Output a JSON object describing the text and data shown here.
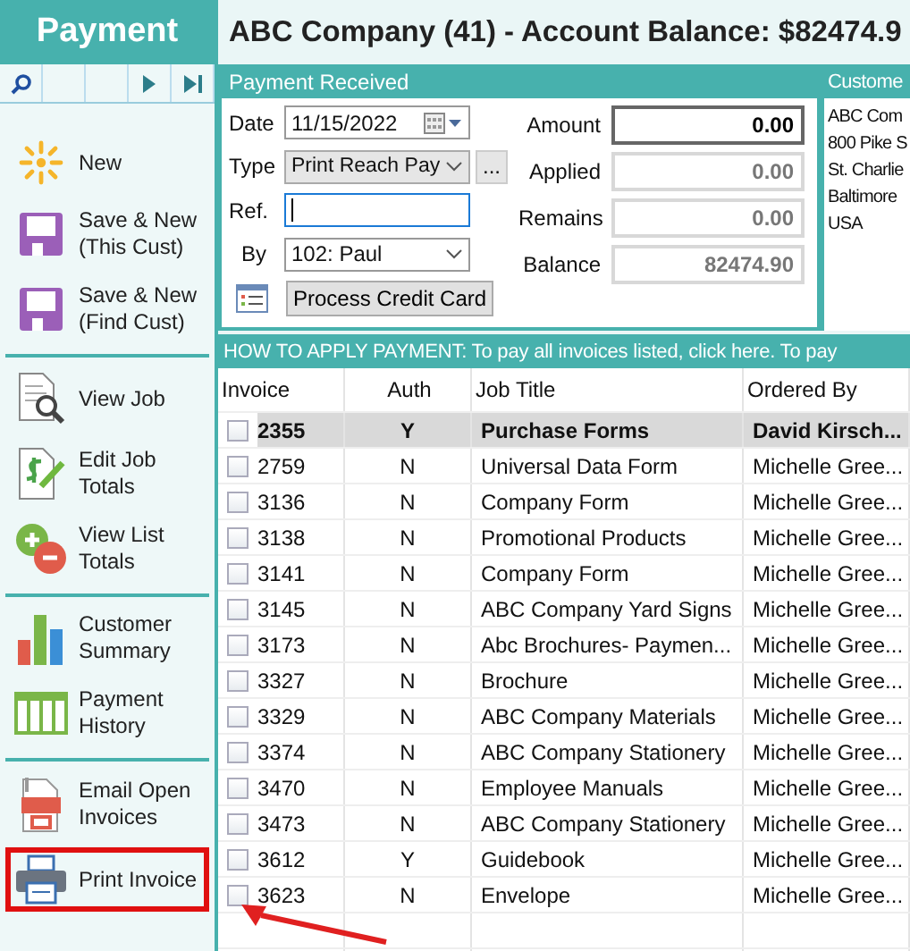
{
  "sidebar": {
    "title": "Payment",
    "groups": [
      {
        "items": [
          {
            "kind": "new",
            "label": "New",
            "highlighted": false
          },
          {
            "kind": "save",
            "label": "Save & New\n(This Cust)",
            "highlighted": false
          },
          {
            "kind": "save",
            "label": "Save & New\n(Find Cust)",
            "highlighted": false
          }
        ]
      },
      {
        "items": [
          {
            "kind": "view-job",
            "label": "View Job",
            "highlighted": false
          },
          {
            "kind": "edit-job",
            "label": "Edit Job\nTotals",
            "highlighted": false
          },
          {
            "kind": "list-totals",
            "label": "View List\nTotals",
            "highlighted": false
          }
        ]
      },
      {
        "items": [
          {
            "kind": "summary",
            "label": "Customer\nSummary",
            "highlighted": false
          },
          {
            "kind": "history",
            "label": "Payment\nHistory",
            "highlighted": false
          }
        ]
      },
      {
        "items": [
          {
            "kind": "pdf",
            "label": "Email Open\nInvoices",
            "highlighted": false
          },
          {
            "kind": "print",
            "label": "Print Invoice",
            "highlighted": true
          }
        ]
      }
    ]
  },
  "title": "ABC Company (41) - Account Balance: $82474.9",
  "payment": {
    "header": "Payment Received",
    "date": {
      "label": "Date",
      "value": "11/15/2022"
    },
    "type": {
      "label": "Type",
      "value": "Print Reach Pay",
      "more": "..."
    },
    "ref": {
      "label": "Ref.",
      "focused": true
    },
    "by": {
      "label": "By",
      "value": "102: Paul"
    },
    "process_button": "Process Credit Card",
    "amounts": [
      {
        "label": "Amount",
        "value": "0.00",
        "editable": true
      },
      {
        "label": "Applied",
        "value": "0.00",
        "editable": false
      },
      {
        "label": "Remains",
        "value": "0.00",
        "editable": false
      },
      {
        "label": "Balance",
        "value": "82474.90",
        "editable": false
      }
    ]
  },
  "customer": {
    "header": "Custome",
    "lines": [
      "ABC Com",
      "800 Pike S",
      "St. Charlie",
      "Baltimore",
      "USA"
    ]
  },
  "apply_bar": "HOW TO APPLY PAYMENT: To pay all invoices listed, click here. To pay",
  "table": {
    "columns": [
      "Invoice",
      "Auth",
      "Job Title",
      "Ordered By"
    ],
    "rows": [
      {
        "invoice": "2355",
        "auth": "Y",
        "job_title": "Purchase Forms",
        "ordered_by": "David Kirsch...",
        "checked": false,
        "selected": true
      },
      {
        "invoice": "2759",
        "auth": "N",
        "job_title": "Universal Data Form",
        "ordered_by": "Michelle Gree...",
        "checked": false,
        "selected": false
      },
      {
        "invoice": "3136",
        "auth": "N",
        "job_title": "Company Form",
        "ordered_by": "Michelle Gree...",
        "checked": false,
        "selected": false
      },
      {
        "invoice": "3138",
        "auth": "N",
        "job_title": "Promotional Products",
        "ordered_by": "Michelle Gree...",
        "checked": false,
        "selected": false
      },
      {
        "invoice": "3141",
        "auth": "N",
        "job_title": "Company Form",
        "ordered_by": "Michelle Gree...",
        "checked": false,
        "selected": false
      },
      {
        "invoice": "3145",
        "auth": "N",
        "job_title": "ABC Company Yard Signs",
        "ordered_by": "Michelle Gree...",
        "checked": false,
        "selected": false
      },
      {
        "invoice": "3173",
        "auth": "N",
        "job_title": "Abc Brochures- Paymen...",
        "ordered_by": "Michelle Gree...",
        "checked": false,
        "selected": false
      },
      {
        "invoice": "3327",
        "auth": "N",
        "job_title": "Brochure",
        "ordered_by": "Michelle Gree...",
        "checked": false,
        "selected": false
      },
      {
        "invoice": "3329",
        "auth": "N",
        "job_title": "ABC Company Materials",
        "ordered_by": "Michelle Gree...",
        "checked": false,
        "selected": false
      },
      {
        "invoice": "3374",
        "auth": "N",
        "job_title": "ABC Company Stationery",
        "ordered_by": "Michelle Gree...",
        "checked": false,
        "selected": false
      },
      {
        "invoice": "3470",
        "auth": "N",
        "job_title": "Employee Manuals",
        "ordered_by": "Michelle Gree...",
        "checked": false,
        "selected": false
      },
      {
        "invoice": "3473",
        "auth": "N",
        "job_title": "ABC Company Stationery",
        "ordered_by": "Michelle Gree...",
        "checked": false,
        "selected": false
      },
      {
        "invoice": "3612",
        "auth": "Y",
        "job_title": "Guidebook",
        "ordered_by": "Michelle Gree...",
        "checked": false,
        "selected": false
      },
      {
        "invoice": "3623",
        "auth": "N",
        "job_title": "Envelope",
        "ordered_by": "Michelle Gree...",
        "checked": false,
        "selected": false
      }
    ]
  }
}
